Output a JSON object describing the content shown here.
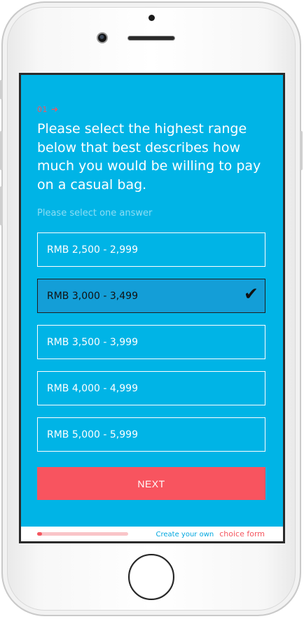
{
  "question": {
    "number": "01",
    "arrow_icon": "arrow-right-icon",
    "text": "Please select the highest range below that best describes how much you would be willing to pay on a casual bag.",
    "hint": "Please select one answer"
  },
  "options": [
    {
      "label": "RMB 2,500 - 2,999",
      "selected": false
    },
    {
      "label": "RMB 3,000 - 3,499",
      "selected": true
    },
    {
      "label": "RMB 3,500 - 3,999",
      "selected": false
    },
    {
      "label": "RMB 4,000 - 4,999",
      "selected": false
    },
    {
      "label": "RMB 5,000 - 5,999",
      "selected": false
    }
  ],
  "next_label": "NEXT",
  "footer": {
    "progress": 0.05,
    "text_a": "Create your own",
    "text_b": "choice form"
  },
  "colors": {
    "background": "#00b4e6",
    "accent": "#f8545f",
    "selected_fill": "#149ed7"
  }
}
